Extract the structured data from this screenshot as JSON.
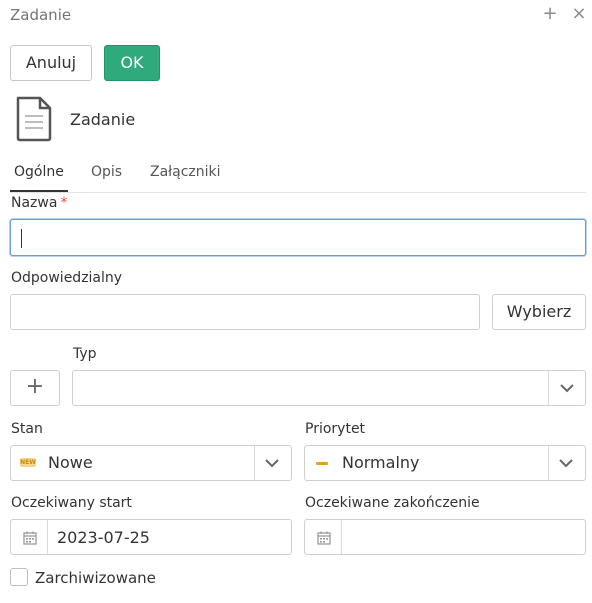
{
  "window": {
    "title": "Zadanie",
    "plus_glyph": "+",
    "close_glyph": "×"
  },
  "actions": {
    "cancel_label": "Anuluj",
    "ok_label": "OK",
    "ok_color": "#2eaa7d"
  },
  "header": {
    "icon": "document-icon",
    "title": "Zadanie"
  },
  "tabs": [
    {
      "label": "Ogólne",
      "active": true
    },
    {
      "label": "Opis",
      "active": false
    },
    {
      "label": "Załączniki",
      "active": false
    }
  ],
  "form": {
    "name": {
      "label": "Nazwa",
      "required_mark": "*",
      "value": ""
    },
    "responsible": {
      "label": "Odpowiedzialny",
      "value": "",
      "choose_label": "Wybierz"
    },
    "type": {
      "label": "Typ",
      "value": "",
      "add_glyph": "+"
    },
    "state": {
      "label": "Stan",
      "value": "Nowe",
      "icon": "new-badge-icon",
      "badge_text": "NEW"
    },
    "priority": {
      "label": "Priorytet",
      "value": "Normalny",
      "icon": "normal-priority-icon",
      "icon_color": "#e6a224"
    },
    "expected_start": {
      "label": "Oczekiwany start",
      "value": "2023-07-25"
    },
    "expected_end": {
      "label": "Oczekiwane zakończenie",
      "value": ""
    },
    "archived": {
      "label": "Zarchiwizowane",
      "checked": false
    }
  }
}
